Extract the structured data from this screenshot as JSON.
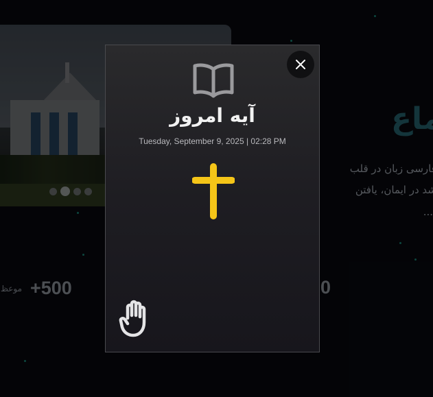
{
  "background": {
    "heading_fragment": "ماع",
    "text_line1": "ش و فارسی زبان در قلب",
    "text_line2": "رای رشد در ایمان، یافتن",
    "text_line3": "...",
    "stat_left_label": "موعظ",
    "stat_left_value": "+500",
    "stat_right_value": "0",
    "carousel_dots": 4,
    "carousel_active_index": 1
  },
  "modal": {
    "title": "آیه امروز",
    "datetime": "Tuesday, September 9, 2025 | 02:28 PM",
    "close_icon": "close-icon",
    "top_icon": "open-book-icon",
    "center_icon": "cross-icon",
    "bottom_icon": "praying-hand-icon",
    "accent_color": "#f5c518"
  }
}
